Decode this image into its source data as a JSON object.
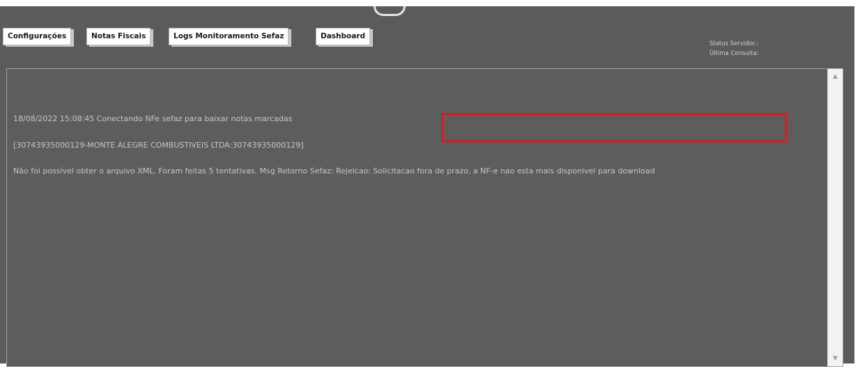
{
  "tabs": [
    {
      "label": "Configurações"
    },
    {
      "label": "Notas Fiscais"
    },
    {
      "label": "Logs Monitoramento Sefaz"
    },
    {
      "label": "Dashboard"
    }
  ],
  "status": {
    "server_label": "Status Servidor.:",
    "last_query_label": "Última Consulta:"
  },
  "log": {
    "lines": [
      "18/08/2022 15:08:45 Conectando NFe sefaz para baixar notas marcadas",
      "[30743935000129-MONTE ALEGRE COMBUSTIVEIS LTDA:30743935000129]",
      "Não foi possível obter o arquivo XML. Foram feitas 5 tentativas. Msg Retorno Sefaz: Rejeicao: Solicitacao fora de prazo, a NF-e nao esta mais disponivel para download"
    ]
  },
  "scrollbar": {
    "up_icon": "▲",
    "down_icon": "▼"
  },
  "colors": {
    "background": "#5b5b5b",
    "log_text": "#c6c6c6",
    "highlight": "#e01919",
    "tab_background": "#ffffff"
  }
}
